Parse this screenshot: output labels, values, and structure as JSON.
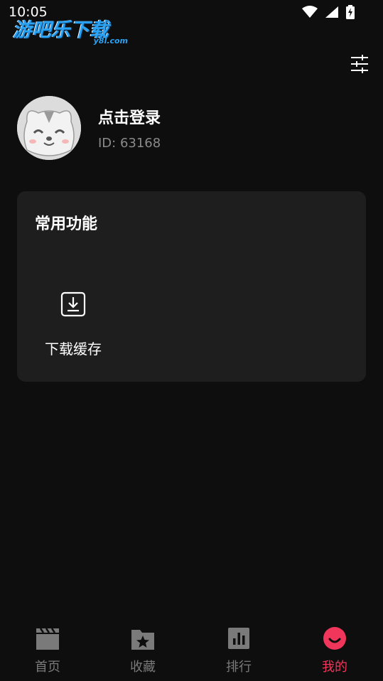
{
  "status_bar": {
    "time": "10:05"
  },
  "watermark": {
    "title": "游吧乐下载",
    "domain": "y8l.com"
  },
  "profile": {
    "login_label": "点击登录",
    "user_id": "ID: 63168"
  },
  "common_functions": {
    "title": "常用功能",
    "items": [
      {
        "label": "下载缓存",
        "icon": "download-icon"
      }
    ]
  },
  "bottom_nav": {
    "items": [
      {
        "label": "首页",
        "icon": "clapperboard-icon",
        "active": false
      },
      {
        "label": "收藏",
        "icon": "star-folder-icon",
        "active": false
      },
      {
        "label": "排行",
        "icon": "bar-chart-icon",
        "active": false
      },
      {
        "label": "我的",
        "icon": "smile-icon",
        "active": true
      }
    ],
    "active_color": "#f0365a",
    "inactive_color": "#7a7a7a"
  }
}
